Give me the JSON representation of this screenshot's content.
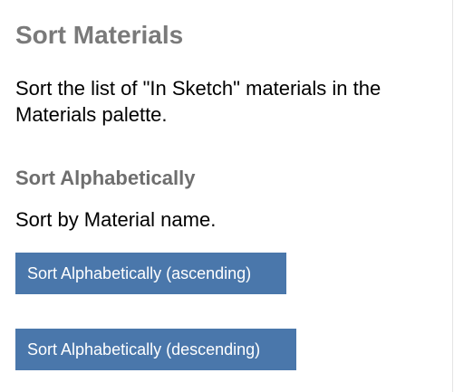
{
  "panel": {
    "title": "Sort Materials",
    "description": "Sort the list of \"In Sketch\" materials in the Materials palette."
  },
  "alphabetical": {
    "heading": "Sort Alphabetically",
    "description": "Sort by Material name.",
    "ascending_label": "Sort Alphabetically (ascending)",
    "descending_label": "Sort Alphabetically (descending)"
  },
  "colors": {
    "title": "#7a7a7a",
    "section_heading": "#6e6e6e",
    "button_bg": "#4a77ab",
    "button_text": "#ffffff"
  }
}
